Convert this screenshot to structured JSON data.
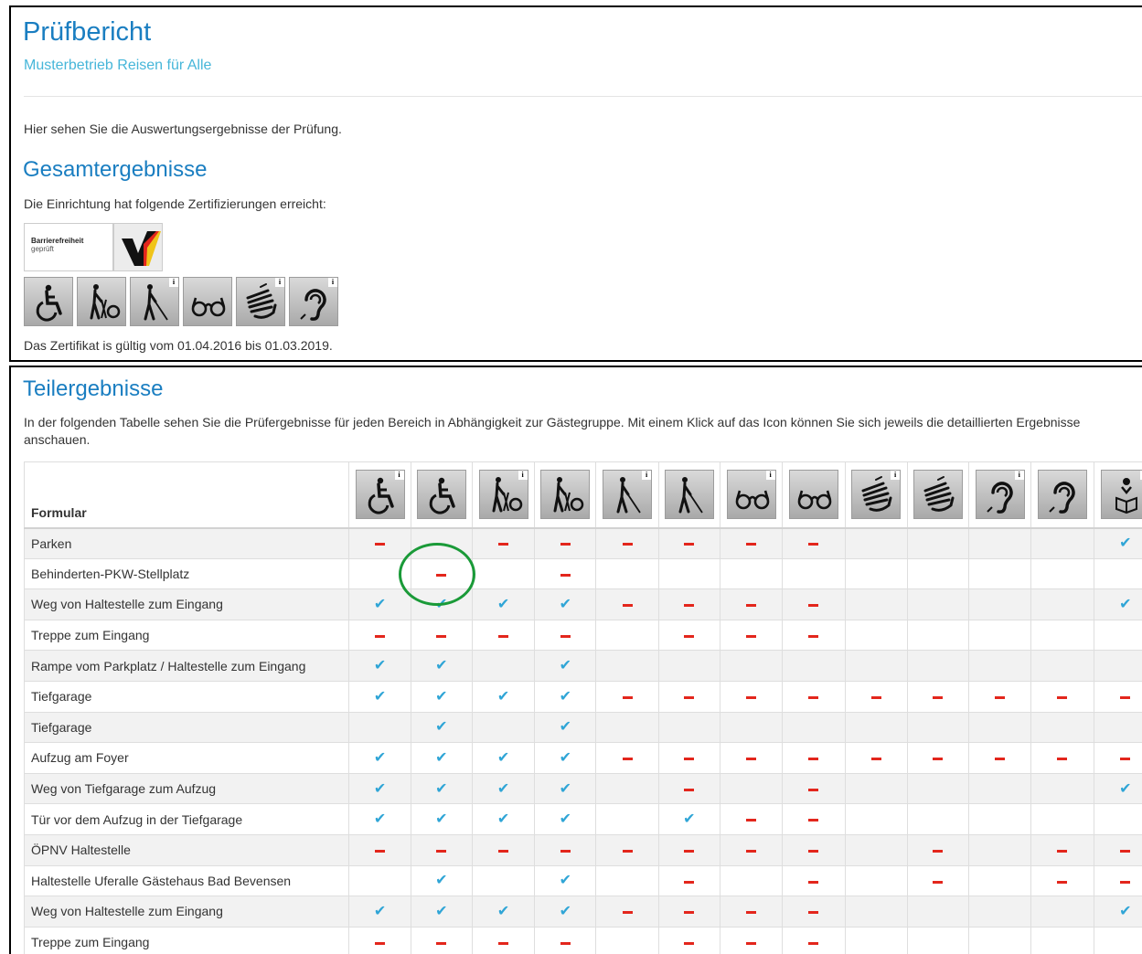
{
  "header": {
    "title": "Prüfbericht",
    "subtitle": "Musterbetrieb Reisen für Alle",
    "intro": "Hier sehen Sie die Auswertungsergebnisse der Prüfung."
  },
  "overall": {
    "heading": "Gesamtergebnisse",
    "achieved_text": "Die Einrichtung hat folgende Zertifizierungen erreicht:",
    "badge_line1": "Barrierefreiheit",
    "badge_line2": "geprüft",
    "badge_mark": "check-mark-logo",
    "info_label": "i",
    "certificates": [
      {
        "icon": "wheelchair-icon",
        "info": false
      },
      {
        "icon": "walking-aid-icon",
        "info": false
      },
      {
        "icon": "blind-cane-icon",
        "info": true
      },
      {
        "icon": "glasses-icon",
        "info": false
      },
      {
        "icon": "sign-language-icon",
        "info": true
      },
      {
        "icon": "ear-icon",
        "info": true
      }
    ],
    "validity": "Das Zertifikat is gültig vom 01.04.2016 bis 01.03.2019."
  },
  "partial": {
    "heading": "Teilergebnisse",
    "description": "In der folgenden Tabelle sehen Sie die Prüfergebnisse für jeden Bereich in Abhängigkeit zur Gästegruppe. Mit einem Klick auf das Icon können Sie sich jeweils die detaillierten Ergebnisse anschauen.",
    "column_header": "Formular",
    "columns": [
      {
        "icon": "wheelchair-icon",
        "info": true
      },
      {
        "icon": "wheelchair-icon",
        "info": false
      },
      {
        "icon": "walking-aid-icon",
        "info": true
      },
      {
        "icon": "walking-aid-icon",
        "info": false
      },
      {
        "icon": "blind-cane-icon",
        "info": true
      },
      {
        "icon": "blind-cane-icon",
        "info": false
      },
      {
        "icon": "glasses-icon",
        "info": true
      },
      {
        "icon": "glasses-icon",
        "info": false
      },
      {
        "icon": "sign-language-icon",
        "info": true
      },
      {
        "icon": "sign-language-icon",
        "info": false
      },
      {
        "icon": "ear-icon",
        "info": true
      },
      {
        "icon": "ear-icon",
        "info": false
      },
      {
        "icon": "reading-person-icon",
        "info": true
      }
    ],
    "check_symbol": "✔",
    "rows": [
      {
        "label": "Parken",
        "marks": [
          "-",
          "",
          "-",
          "-",
          "-",
          "-",
          "-",
          "-",
          "",
          "",
          "",
          "",
          "ok"
        ]
      },
      {
        "label": "Behinderten-PKW-Stellplatz",
        "marks": [
          "",
          "-",
          "",
          "-",
          "",
          "",
          "",
          "",
          "",
          "",
          "",
          "",
          ""
        ]
      },
      {
        "label": "Weg von Haltestelle zum Eingang",
        "marks": [
          "ok",
          "ok",
          "ok",
          "ok",
          "-",
          "-",
          "-",
          "-",
          "",
          "",
          "",
          "",
          "ok"
        ]
      },
      {
        "label": "Treppe zum Eingang",
        "marks": [
          "-",
          "-",
          "-",
          "-",
          "",
          "-",
          "-",
          "-",
          "",
          "",
          "",
          "",
          ""
        ]
      },
      {
        "label": "Rampe vom Parkplatz / Haltestelle zum Eingang",
        "marks": [
          "ok",
          "ok",
          "",
          "ok",
          "",
          "",
          "",
          "",
          "",
          "",
          "",
          "",
          ""
        ]
      },
      {
        "label": "Tiefgarage",
        "marks": [
          "ok",
          "ok",
          "ok",
          "ok",
          "-",
          "-",
          "-",
          "-",
          "-",
          "-",
          "-",
          "-",
          "-"
        ]
      },
      {
        "label": "Tiefgarage",
        "marks": [
          "",
          "ok",
          "",
          "ok",
          "",
          "",
          "",
          "",
          "",
          "",
          "",
          "",
          ""
        ]
      },
      {
        "label": "Aufzug am Foyer",
        "marks": [
          "ok",
          "ok",
          "ok",
          "ok",
          "-",
          "-",
          "-",
          "-",
          "-",
          "-",
          "-",
          "-",
          "-"
        ]
      },
      {
        "label": "Weg von Tiefgarage zum Aufzug",
        "marks": [
          "ok",
          "ok",
          "ok",
          "ok",
          "",
          "-",
          "",
          "-",
          "",
          "",
          "",
          "",
          "ok"
        ]
      },
      {
        "label": "Tür vor dem Aufzug in der Tiefgarage",
        "marks": [
          "ok",
          "ok",
          "ok",
          "ok",
          "",
          "ok",
          "-",
          "-",
          "",
          "",
          "",
          "",
          ""
        ]
      },
      {
        "label": "ÖPNV Haltestelle",
        "marks": [
          "-",
          "-",
          "-",
          "-",
          "-",
          "-",
          "-",
          "-",
          "",
          "-",
          "",
          "-",
          "-"
        ]
      },
      {
        "label": "Haltestelle Uferalle Gästehaus Bad Bevensen",
        "marks": [
          "",
          "ok",
          "",
          "ok",
          "",
          "-",
          "",
          "-",
          "",
          "-",
          "",
          "-",
          "-"
        ]
      },
      {
        "label": "Weg von Haltestelle zum Eingang",
        "marks": [
          "ok",
          "ok",
          "ok",
          "ok",
          "-",
          "-",
          "-",
          "-",
          "",
          "",
          "",
          "",
          "ok"
        ]
      },
      {
        "label": "Treppe zum Eingang",
        "marks": [
          "-",
          "-",
          "-",
          "-",
          "",
          "-",
          "-",
          "-",
          "",
          "",
          "",
          "",
          ""
        ]
      }
    ]
  },
  "colors": {
    "heading": "#1a7ec1",
    "subtitle": "#46b6d9",
    "check": "#2fa5d6",
    "dash": "#e3261c",
    "annotation": "#1a9a38"
  }
}
